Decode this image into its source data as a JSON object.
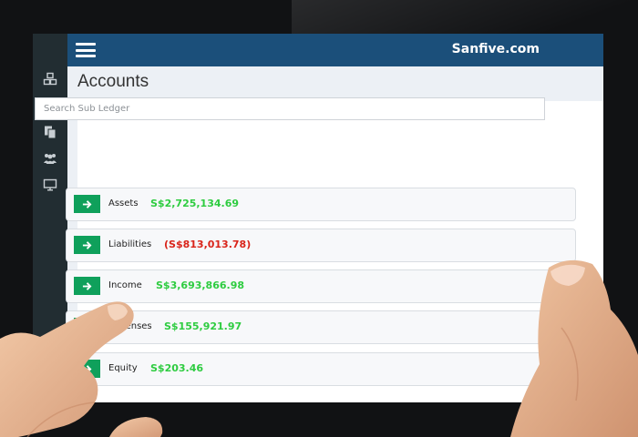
{
  "header": {
    "brand": "Sanfive.com"
  },
  "page": {
    "title": "Accounts"
  },
  "search": {
    "placeholder": "Search Sub Ledger"
  },
  "sidebar": {
    "items": [
      {
        "icon": "cubes-icon"
      },
      {
        "icon": "balance-scale-icon"
      },
      {
        "icon": "documents-icon"
      },
      {
        "icon": "users-icon"
      },
      {
        "icon": "monitor-icon"
      }
    ]
  },
  "accounts": [
    {
      "name": "Assets",
      "amount": "S$2,725,134.69",
      "status": "positive"
    },
    {
      "name": "Liabilities",
      "amount": "(S$813,013.78)",
      "status": "negative"
    },
    {
      "name": "Income",
      "amount": "S$3,693,866.98",
      "status": "positive"
    },
    {
      "name": "Expenses",
      "amount": "S$155,921.97",
      "status": "positive"
    },
    {
      "name": "Equity",
      "amount": "S$203.46",
      "status": "positive"
    }
  ],
  "colors": {
    "topbar": "#1b4f7a",
    "sidebar": "#222d32",
    "button": "#0fa05b",
    "positive": "#2ecc40",
    "negative": "#d9241a"
  }
}
